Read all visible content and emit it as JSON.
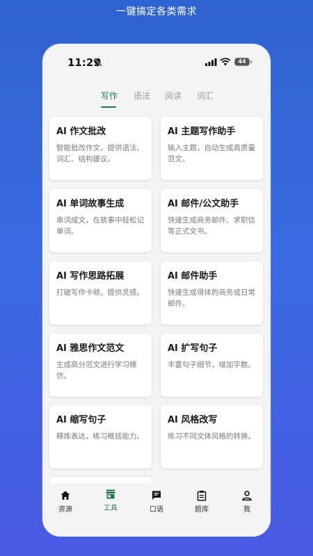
{
  "promo": {
    "caption": "一键搞定各类需求"
  },
  "status": {
    "time": "11:29",
    "battery": "44"
  },
  "tabs": [
    {
      "label": "写作",
      "active": true
    },
    {
      "label": "语法",
      "active": false
    },
    {
      "label": "阅读",
      "active": false
    },
    {
      "label": "词汇",
      "active": false
    }
  ],
  "cards": [
    {
      "title": "AI 作文批改",
      "desc": "智能批改作文，提供语法、词汇、结构建议。"
    },
    {
      "title": "AI 主题写作助手",
      "desc": "输入主题，自动生成高质量范文。"
    },
    {
      "title": "AI 单词故事生成",
      "desc": "串词成文，在故事中轻松记单词。"
    },
    {
      "title": "AI 邮件/公文助手",
      "desc": "快速生成商务邮件、求职信等正式文书。"
    },
    {
      "title": "AI 写作思路拓展",
      "desc": "打破写作卡顿，提供灵感。"
    },
    {
      "title": "AI 邮件助手",
      "desc": "快速生成得体的商务或日常邮件。"
    },
    {
      "title": "AI 雅思作文范文",
      "desc": "生成高分范文进行学习模仿。"
    },
    {
      "title": "AI 扩写句子",
      "desc": "丰富句子细节，增加字数。"
    },
    {
      "title": "AI 缩写句子",
      "desc": "精炼表达，练习概括能力。"
    },
    {
      "title": "AI 风格改写",
      "desc": "练习不同文体风格的转换。"
    }
  ],
  "nav": [
    {
      "label": "资源",
      "icon": "home-icon",
      "active": false
    },
    {
      "label": "工具",
      "icon": "store-icon",
      "active": true
    },
    {
      "label": "口语",
      "icon": "chat-icon",
      "active": false
    },
    {
      "label": "题库",
      "icon": "clipboard-icon",
      "active": false
    },
    {
      "label": "我",
      "icon": "person-icon",
      "active": false
    }
  ],
  "colors": {
    "accent": "#1e7a4e",
    "background_top": "#2f63cf",
    "background_bottom": "#4a5ae3"
  }
}
